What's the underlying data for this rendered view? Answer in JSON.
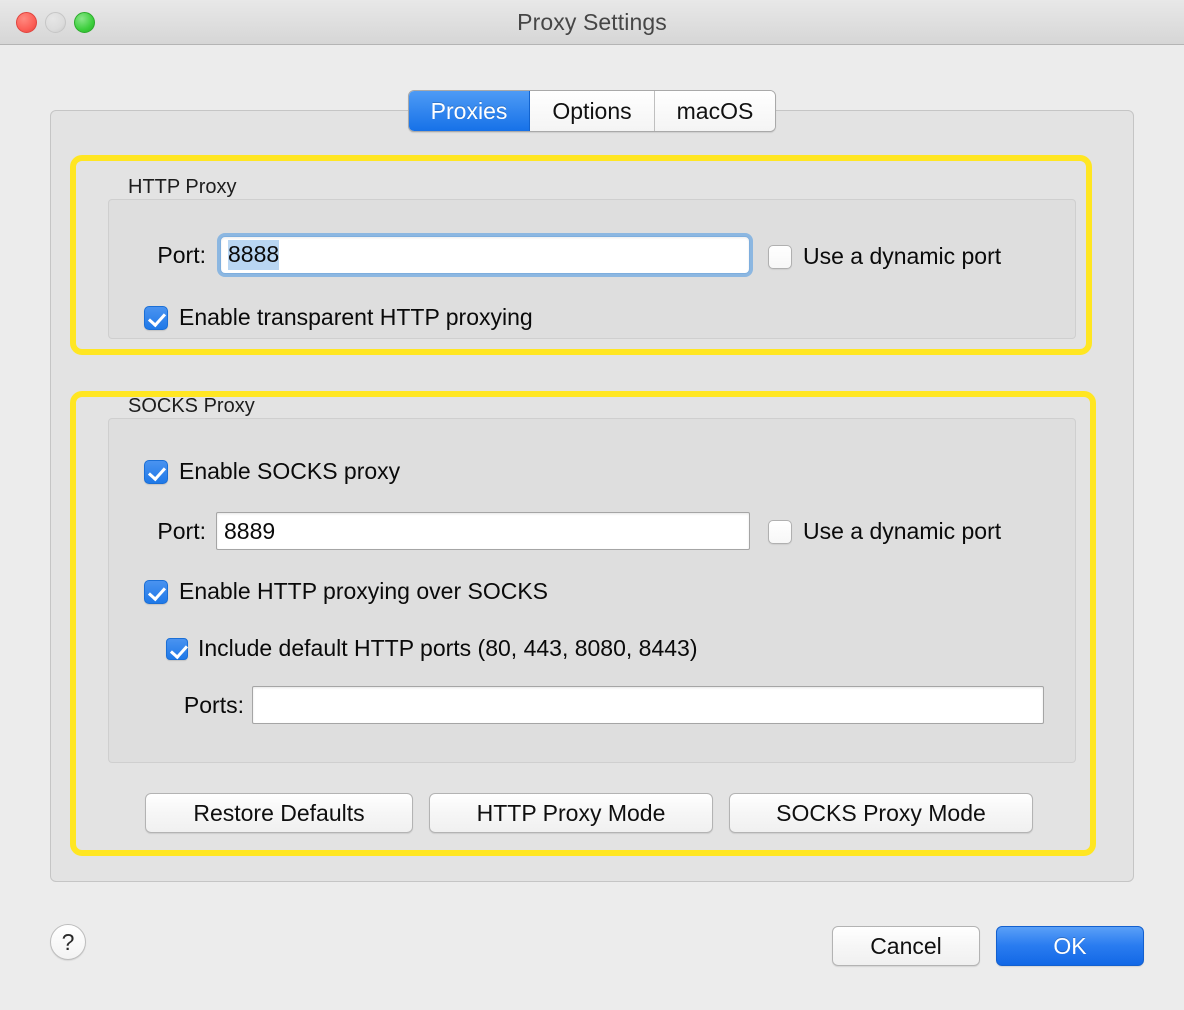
{
  "window": {
    "title": "Proxy Settings",
    "traffic_lights": [
      "close-button",
      "minimize-button",
      "maximize-button"
    ]
  },
  "tabs": [
    {
      "label": "Proxies",
      "active": true
    },
    {
      "label": "Options",
      "active": false
    },
    {
      "label": "macOS",
      "active": false
    }
  ],
  "http_proxy": {
    "group_title": "HTTP Proxy",
    "port_label": "Port:",
    "port_value": "8888",
    "port_focused": true,
    "port_selected": true,
    "dynamic_port_label": "Use a dynamic port",
    "dynamic_port_checked": false,
    "transparent_label": "Enable transparent HTTP proxying",
    "transparent_checked": true,
    "highlighted": true
  },
  "socks_proxy": {
    "group_title": "SOCKS Proxy",
    "enable_label": "Enable SOCKS proxy",
    "enable_checked": true,
    "port_label": "Port:",
    "port_value": "8889",
    "dynamic_port_label": "Use a dynamic port",
    "dynamic_port_checked": false,
    "http_over_socks_label": "Enable HTTP proxying over SOCKS",
    "http_over_socks_checked": true,
    "include_default_label": "Include default HTTP ports (80, 443, 8080, 8443)",
    "include_default_checked": true,
    "ports_label": "Ports:",
    "ports_value": "",
    "highlighted": true
  },
  "mode_buttons": [
    {
      "label": "Restore Defaults"
    },
    {
      "label": "HTTP Proxy Mode"
    },
    {
      "label": "SOCKS Proxy Mode"
    }
  ],
  "footer": {
    "help_label": "?",
    "cancel_label": "Cancel",
    "ok_label": "OK"
  },
  "colors": {
    "highlight": "#ffe622",
    "accent_blue": "#1f79e8",
    "selection_blue": "#b9d6f2",
    "window_bg": "#ececec",
    "panel_bg": "#e3e3e3",
    "group_bg": "#dedede"
  }
}
